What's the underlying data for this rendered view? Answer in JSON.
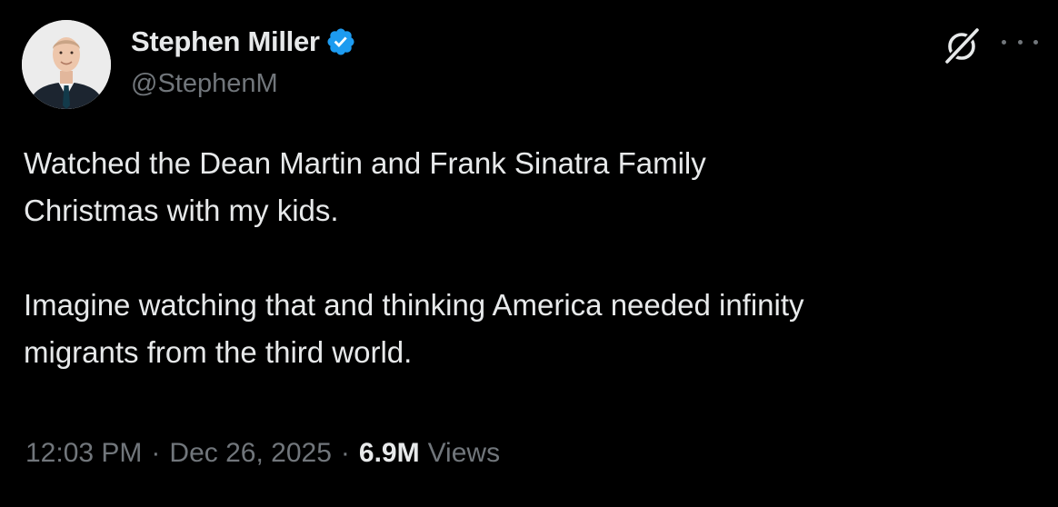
{
  "author": {
    "display_name": "Stephen Miller",
    "handle": "@StephenM",
    "verified": true,
    "verified_color": "#1d9bf0",
    "avatar_icon": "profile-photo"
  },
  "tweet": {
    "paragraphs": [
      [
        "Watched the Dean Martin and Frank Sinatra Family",
        "Christmas with my kids."
      ],
      [
        "Imagine watching that and thinking America needed infinity",
        "migrants from the third world."
      ]
    ],
    "time": "12:03 PM",
    "date": "Dec 26, 2025",
    "separator": "·",
    "views_count": "6.9M",
    "views_label": "Views"
  },
  "actions": {
    "grok_icon": "grok-icon",
    "more_icon": "more-icon"
  },
  "colors": {
    "background": "#000000",
    "primary_text": "#e7e9ea",
    "secondary_text": "#71767b"
  }
}
